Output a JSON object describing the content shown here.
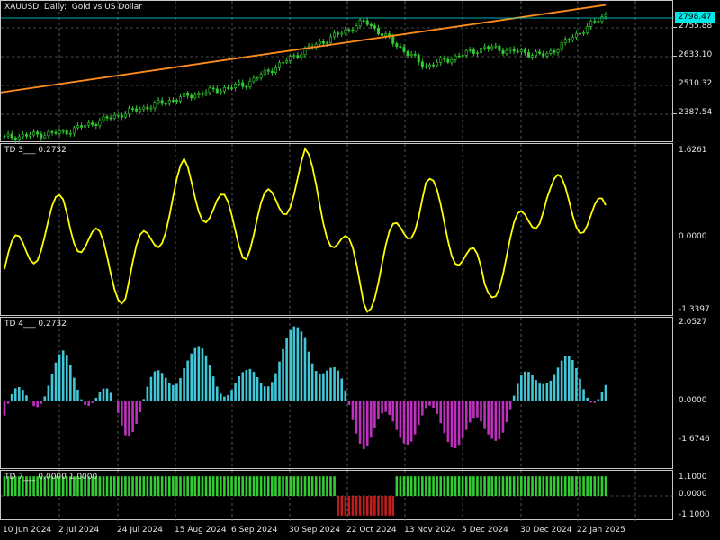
{
  "chart_title": "XAUUSD, Daily:  Gold vs US Dollar",
  "current_price": "2798.47",
  "colors": {
    "background": "#000000",
    "grid": "#8c8c8c",
    "candle": "#32cd32",
    "trendline": "#ff8c1a",
    "td3_line": "#ffff00",
    "td4_positive": "#40c8d8",
    "td4_negative": "#c030c0",
    "td7_positive": "#32cd32",
    "td7_negative": "#c01e1e",
    "price_line": "#00e8e8"
  },
  "price_axis_labels": [
    "2755.88",
    "2633.10",
    "2510.32",
    "2387.54"
  ],
  "panes": {
    "td3": {
      "title": "TD 3___ 0.2732",
      "axis_labels": [
        "1.6261",
        "0.0000",
        "-1.3397"
      ]
    },
    "td4": {
      "title": "TD 4___ 0.2732",
      "axis_labels": [
        "2.0527",
        "0.0000",
        "-1.6746"
      ]
    },
    "td7": {
      "title": "TD 7___ 0.0000 1.0000",
      "axis_labels": [
        "1.1000",
        "0.0000",
        "-1.1000"
      ]
    }
  },
  "time_axis_labels": [
    "10 Jun 2024",
    "2 Jul 2024",
    "24 Jul 2024",
    "15 Aug 2024",
    "6 Sep 2024",
    "30 Sep 2024",
    "22 Oct 2024",
    "13 Nov 2024",
    "5 Dec 2024",
    "30 Dec 2024",
    "22 Jan 2025"
  ],
  "chart_data": [
    {
      "type": "line",
      "title": "XAUUSD, Daily:  Gold vs US Dollar",
      "description_series": "close price (approximate, sampled)",
      "x": [
        "10 Jun 2024",
        "2 Jul 2024",
        "24 Jul 2024",
        "15 Aug 2024",
        "6 Sep 2024",
        "30 Sep 2024",
        "22 Oct 2024",
        "13 Nov 2024",
        "5 Dec 2024",
        "30 Dec 2024",
        "22 Jan 2025"
      ],
      "series": [
        {
          "values": [
            2310,
            2330,
            2400,
            2460,
            2505,
            2630,
            2735,
            2570,
            2640,
            2610,
            2760
          ]
        }
      ],
      "yticks": [
        2387.54,
        2510.32,
        2633.1,
        2755.88
      ],
      "ylim": [
        2290,
        2810
      ],
      "trendline": {
        "from": 2475,
        "to": 2795
      }
    },
    {
      "type": "line",
      "name": "TD 3",
      "ylim": [
        -1.3397,
        1.6261
      ],
      "x": [
        "10 Jun 2024",
        "2 Jul 2024",
        "24 Jul 2024",
        "15 Aug 2024",
        "6 Sep 2024",
        "30 Sep 2024",
        "22 Oct 2024",
        "13 Nov 2024",
        "5 Dec 2024",
        "30 Dec 2024",
        "22 Jan 2025"
      ],
      "values": [
        -0.6,
        0.5,
        -0.9,
        1.1,
        0.0,
        1.3,
        -1.1,
        0.9,
        -1.0,
        0.9,
        0.27
      ]
    },
    {
      "type": "bar",
      "name": "TD 4",
      "ylim": [
        -1.6746,
        2.0527
      ],
      "x": [
        "10 Jun 2024",
        "2 Jul 2024",
        "24 Jul 2024",
        "15 Aug 2024",
        "6 Sep 2024",
        "30 Sep 2024",
        "22 Oct 2024",
        "13 Nov 2024",
        "5 Dec 2024",
        "30 Dec 2024",
        "22 Jan 2025"
      ],
      "values": [
        -0.4,
        0.9,
        -0.6,
        1.2,
        0.3,
        1.8,
        -0.9,
        -0.6,
        -1.0,
        1.0,
        0.27
      ]
    },
    {
      "type": "bar",
      "name": "TD 7",
      "ylim": [
        -1.1,
        1.1
      ],
      "x": [
        "10 Jun 2024",
        "2 Jul 2024",
        "24 Jul 2024",
        "15 Aug 2024",
        "6 Sep 2024",
        "30 Sep 2024",
        "22 Oct 2024",
        "13 Nov 2024",
        "5 Dec 2024",
        "30 Dec 2024",
        "22 Jan 2025"
      ],
      "values": [
        1,
        1,
        1,
        1,
        1,
        1,
        -1,
        1,
        1,
        1,
        1
      ]
    }
  ]
}
